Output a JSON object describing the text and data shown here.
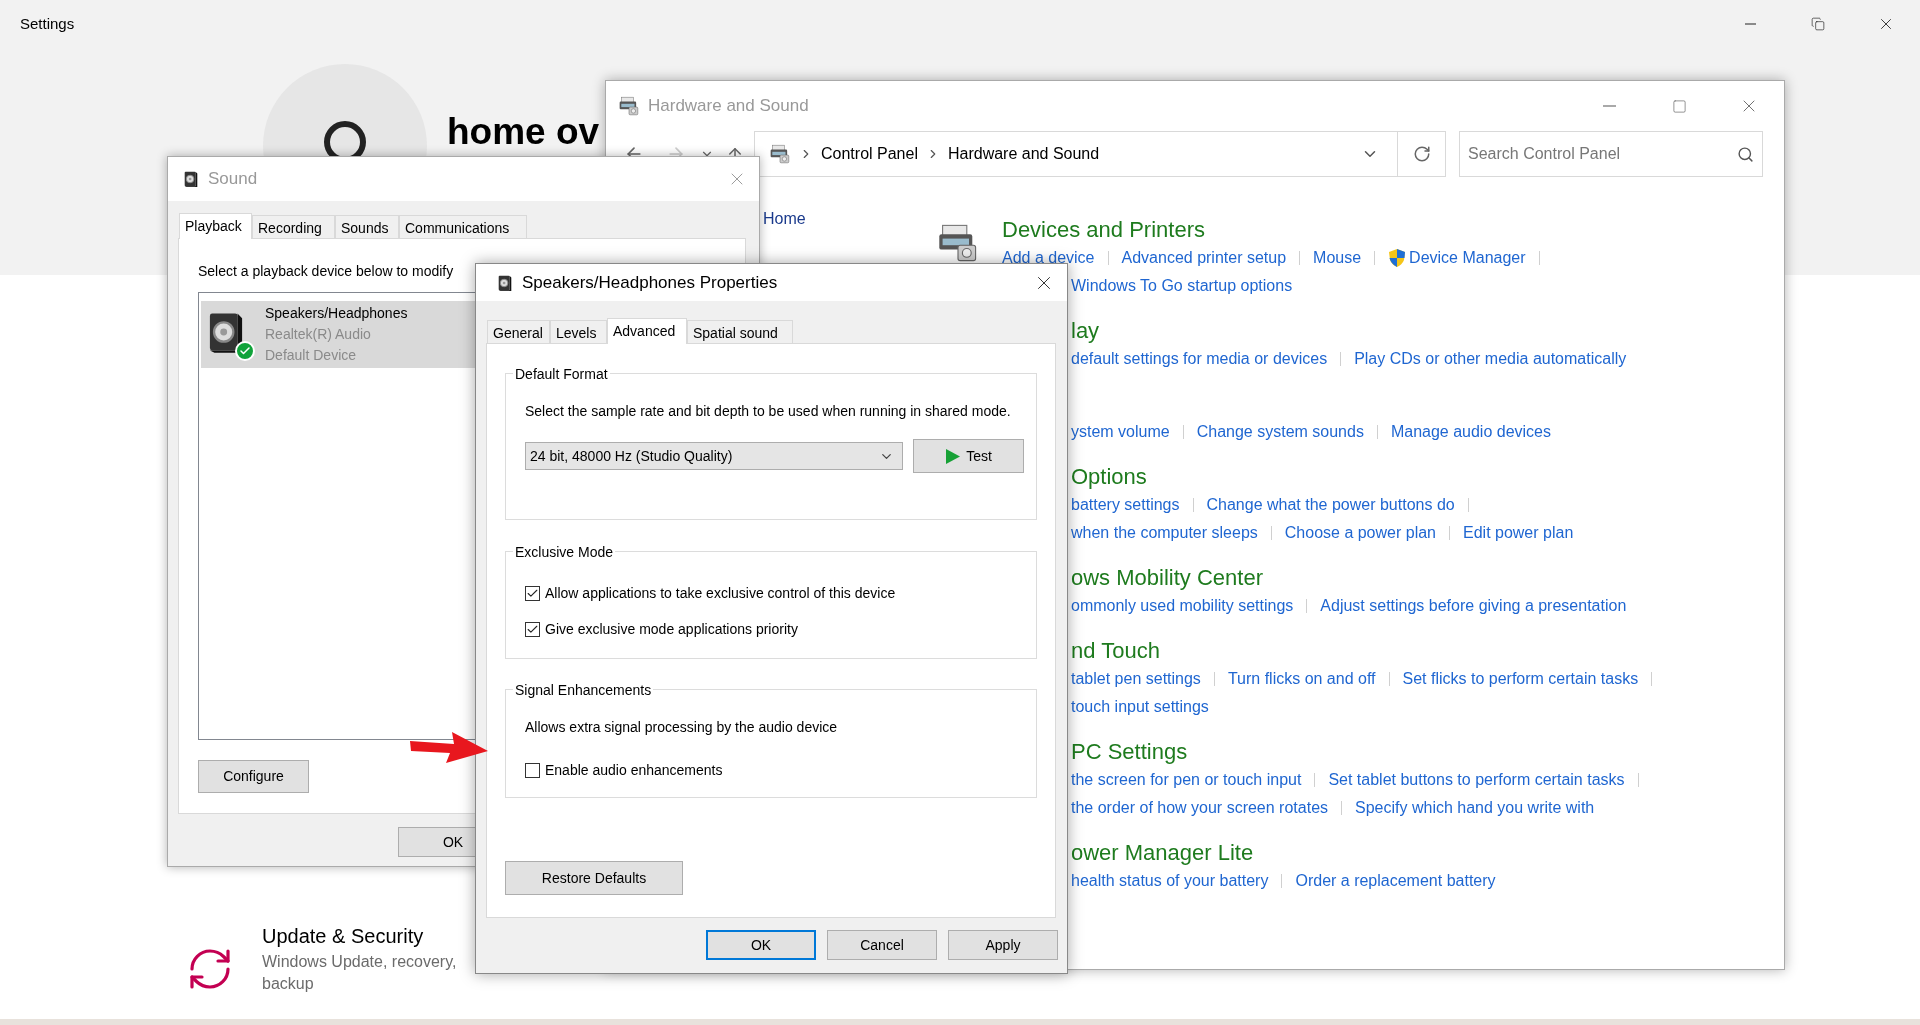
{
  "settings": {
    "title": "Settings",
    "user_name": "home ov",
    "categories": [
      {
        "title": "Update & Security",
        "description": "Windows Update, recovery, backup"
      }
    ]
  },
  "control_panel": {
    "title": "Hardware and Sound",
    "breadcrumb": [
      "Control Panel",
      "Hardware and Sound"
    ],
    "search": {
      "placeholder": "Search Control Panel"
    },
    "sidebar": [
      {
        "label": "Home"
      }
    ],
    "sections": [
      {
        "heading": {
          "text": "Devices and Printers",
          "cut": false
        },
        "rows": [
          {
            "cut": false,
            "trailing_separator": true,
            "links": [
              {
                "text": "Add a device",
                "kind": "plain"
              },
              {
                "text": "Advanced printer setup",
                "kind": "plain"
              },
              {
                "text": "Mouse",
                "kind": "plain"
              },
              {
                "text": "Device Manager",
                "kind": "admin"
              }
            ]
          },
          {
            "cut": true,
            "trailing_separator": false,
            "links": [
              {
                "text": "Windows To Go startup options",
                "kind": "plain"
              }
            ]
          }
        ]
      },
      {
        "heading": {
          "text": "lay",
          "cut": true
        },
        "rows": [
          {
            "cut": true,
            "trailing_separator": false,
            "links": [
              {
                "text": "default settings for media or devices",
                "kind": "plain"
              },
              {
                "text": "Play CDs or other media automatically",
                "kind": "plain"
              }
            ]
          }
        ]
      },
      {
        "rows": [
          {
            "cut": true,
            "trailing_separator": false,
            "links": [
              {
                "text": "ystem volume",
                "kind": "plain"
              },
              {
                "text": "Change system sounds",
                "kind": "plain"
              },
              {
                "text": "Manage audio devices",
                "kind": "plain"
              }
            ]
          }
        ]
      },
      {
        "heading": {
          "text": "Options",
          "cut": true
        },
        "rows": [
          {
            "cut": true,
            "trailing_separator": true,
            "links": [
              {
                "text": "battery settings",
                "kind": "plain"
              },
              {
                "text": "Change what the power buttons do",
                "kind": "plain"
              }
            ]
          },
          {
            "cut": true,
            "trailing_separator": false,
            "links": [
              {
                "text": "when the computer sleeps",
                "kind": "plain"
              },
              {
                "text": "Choose a power plan",
                "kind": "plain"
              },
              {
                "text": "Edit power plan",
                "kind": "plain"
              }
            ]
          }
        ]
      },
      {
        "heading": {
          "text": "ows Mobility Center",
          "cut": true
        },
        "rows": [
          {
            "cut": true,
            "trailing_separator": false,
            "links": [
              {
                "text": "ommonly used mobility settings",
                "kind": "plain"
              },
              {
                "text": "Adjust settings before giving a presentation",
                "kind": "plain"
              }
            ]
          }
        ]
      },
      {
        "heading": {
          "text": "nd Touch",
          "cut": true
        },
        "rows": [
          {
            "cut": true,
            "trailing_separator": true,
            "links": [
              {
                "text": "tablet pen settings",
                "kind": "plain"
              },
              {
                "text": "Turn flicks on and off",
                "kind": "plain"
              },
              {
                "text": "Set flicks to perform certain tasks",
                "kind": "plain"
              }
            ]
          },
          {
            "cut": true,
            "trailing_separator": false,
            "links": [
              {
                "text": "touch input settings",
                "kind": "plain"
              }
            ]
          }
        ]
      },
      {
        "heading": {
          "text": "PC Settings",
          "cut": true
        },
        "rows": [
          {
            "cut": true,
            "trailing_separator": true,
            "links": [
              {
                "text": "the screen for pen or touch input",
                "kind": "plain"
              },
              {
                "text": "Set tablet buttons to perform certain tasks",
                "kind": "plain"
              }
            ]
          },
          {
            "cut": true,
            "trailing_separator": false,
            "links": [
              {
                "text": "the order of how your screen rotates",
                "kind": "plain"
              },
              {
                "text": "Specify which hand you write with",
                "kind": "plain"
              }
            ]
          }
        ]
      },
      {
        "heading": {
          "text": "ower Manager Lite",
          "cut": true
        },
        "rows": [
          {
            "cut": true,
            "trailing_separator": false,
            "links": [
              {
                "text": "health status of your battery",
                "kind": "plain"
              },
              {
                "text": "Order a replacement battery",
                "kind": "plain"
              }
            ]
          }
        ]
      }
    ]
  },
  "sound_dialog": {
    "title": "Sound",
    "tabs": [
      {
        "label": "Playback",
        "selected": true
      },
      {
        "label": "Recording",
        "selected": false
      },
      {
        "label": "Sounds",
        "selected": false
      },
      {
        "label": "Communications",
        "selected": false
      }
    ],
    "instruction": "Select a playback device below to modify",
    "devices": [
      {
        "name": "Speakers/Headphones",
        "driver": "Realtek(R) Audio",
        "status": "Default Device",
        "selected": true,
        "default": true
      }
    ],
    "configure_button": "Configure",
    "footer_buttons": [
      "OK"
    ]
  },
  "properties_dialog": {
    "title": "Speakers/Headphones Properties",
    "tabs": [
      {
        "label": "General",
        "selected": false
      },
      {
        "label": "Levels",
        "selected": false
      },
      {
        "label": "Advanced",
        "selected": true
      },
      {
        "label": "Spatial sound",
        "selected": false
      }
    ],
    "groups": [
      {
        "legend": "Default Format",
        "kind": "format",
        "description": "Select the sample rate and bit depth to be used when running in shared mode.",
        "format": {
          "value": "24 bit, 48000 Hz (Studio Quality)"
        },
        "test_button": "Test"
      },
      {
        "legend": "Exclusive Mode",
        "kind": "options",
        "options": [
          {
            "label": "Allow applications to take exclusive control of this device",
            "checked": true
          },
          {
            "label": "Give exclusive mode applications priority",
            "checked": true
          }
        ]
      },
      {
        "legend": "Signal Enhancements",
        "kind": "options",
        "description": "Allows extra signal processing by the audio device",
        "options": [
          {
            "label": "Enable audio enhancements",
            "checked": false
          }
        ]
      }
    ],
    "restore_button": "Restore Defaults",
    "footer_buttons": [
      {
        "label": "OK",
        "default": true
      },
      {
        "label": "Cancel",
        "default": false
      },
      {
        "label": "Apply",
        "default": false
      }
    ]
  }
}
